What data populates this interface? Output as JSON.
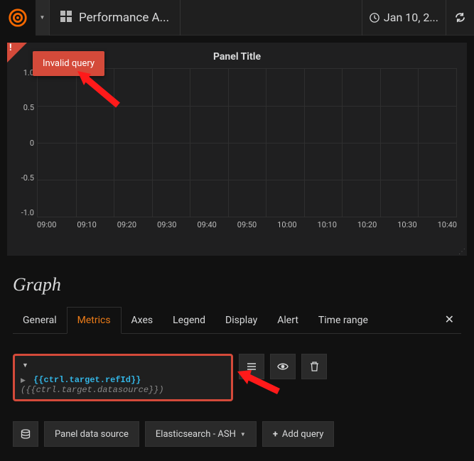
{
  "header": {
    "dashboard_title": "Performance A...",
    "timerange": "Jan 10, 2..."
  },
  "panel": {
    "title": "Panel Title",
    "error_text": "Invalid query"
  },
  "chart_data": {
    "type": "line",
    "title": "Panel Title",
    "xlabel": "",
    "ylabel": "",
    "ylim": [
      -1.0,
      1.0
    ],
    "y_ticks": [
      "1.0",
      "0.5",
      "0",
      "-0.5",
      "-1.0"
    ],
    "x_ticks": [
      "09:00",
      "09:10",
      "09:20",
      "09:30",
      "09:40",
      "09:50",
      "10:00",
      "10:10",
      "10:20",
      "10:30",
      "10:40"
    ],
    "series": []
  },
  "editor": {
    "title": "Graph",
    "tabs": [
      "General",
      "Metrics",
      "Axes",
      "Legend",
      "Display",
      "Alert",
      "Time range"
    ],
    "active_tab": "Metrics"
  },
  "query": {
    "refid_template": "{{ctrl.target.refId}}",
    "datasource_template": "({{ctrl.target.datasource}})"
  },
  "footer": {
    "panel_ds_label": "Panel data source",
    "selected_ds": "Elasticsearch - ASH",
    "add_query": "Add query"
  }
}
